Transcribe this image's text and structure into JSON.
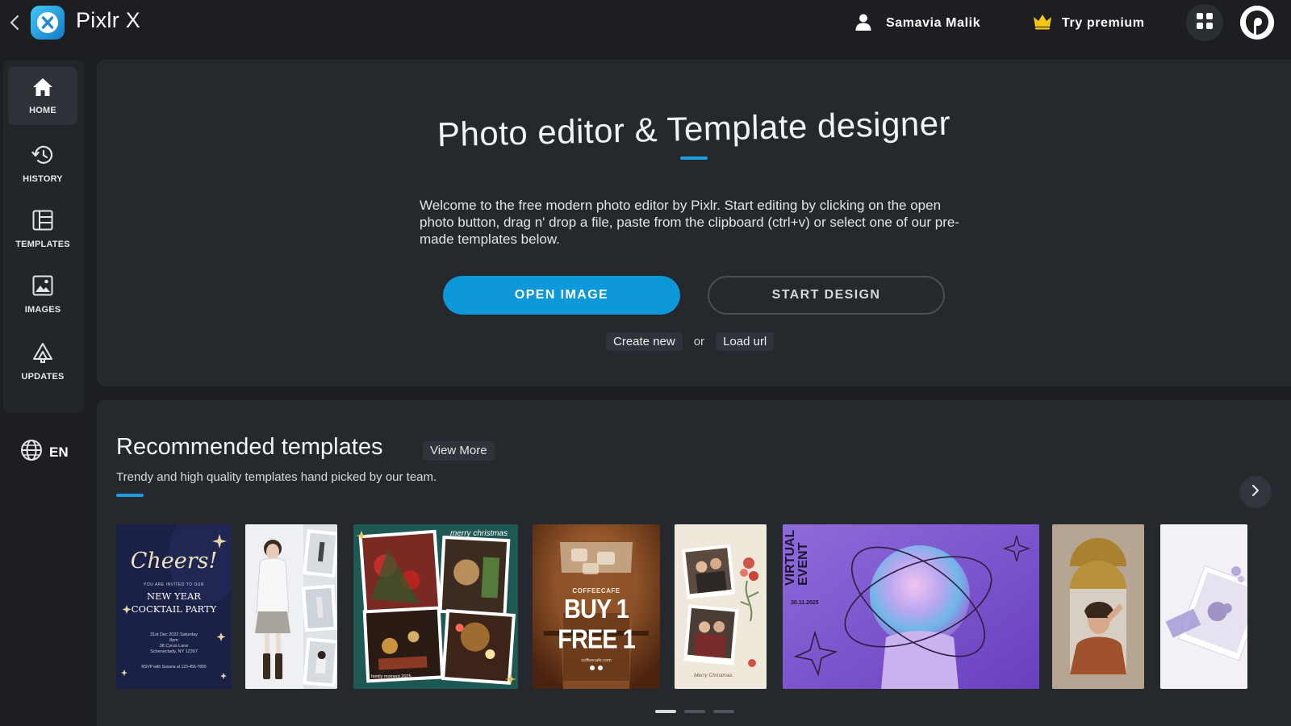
{
  "topbar": {
    "app_name": "Pixlr X",
    "user_name": "Samavia Malik",
    "premium_label": "Try premium"
  },
  "sidebar": {
    "items": [
      {
        "label": "HOME",
        "icon": "home-icon"
      },
      {
        "label": "HISTORY",
        "icon": "history-icon"
      },
      {
        "label": "TEMPLATES",
        "icon": "templates-icon"
      },
      {
        "label": "IMAGES",
        "icon": "image-icon"
      },
      {
        "label": "UPDATES",
        "icon": "megaphone-icon"
      }
    ],
    "language": "EN"
  },
  "hero": {
    "title": "Photo editor & Template designer",
    "description": "Welcome to the free modern photo editor by Pixlr. Start editing by clicking on the open photo button, drag n' drop a file, paste from the clipboard (ctrl+v) or select one of our pre-made templates below.",
    "open_image": "OPEN IMAGE",
    "start_design": "START DESIGN",
    "create_new": "Create new",
    "or": "or",
    "load_url": "Load url"
  },
  "recommended": {
    "title": "Recommended templates",
    "view_more": "View More",
    "subtitle": "Trendy and high quality templates hand picked by our team.",
    "templates": [
      {
        "cheers": "Cheers!",
        "invite": "YOU ARE INVITED TO OUR",
        "line1": "NEW YEAR",
        "line2": "COCKTAIL PARTY",
        "date": "31st Dec 2022 Saturday",
        "time": "8pm",
        "addr1": "38 Cyrus Lane",
        "addr2": "Schenectady, NY 12307",
        "rsvp": "RSVP with Susana at 123-456-7890"
      },
      {},
      {
        "caption": "merry christmas",
        "footer": "family moment 2025"
      },
      {
        "brand": "COFFEECAFE",
        "headline": "BUY 1 FREE 1",
        "site": "coffeecafe.com"
      },
      {
        "signature": "Merry Christmas"
      },
      {
        "line1": "VIRTUAL",
        "line2": "EVENT",
        "date": "30.11.2025"
      },
      {},
      {}
    ],
    "page_dots": 3,
    "active_dot": 0
  },
  "colors": {
    "accent": "#0d98d9",
    "background": "#1c1e22",
    "panel": "#25282d"
  }
}
